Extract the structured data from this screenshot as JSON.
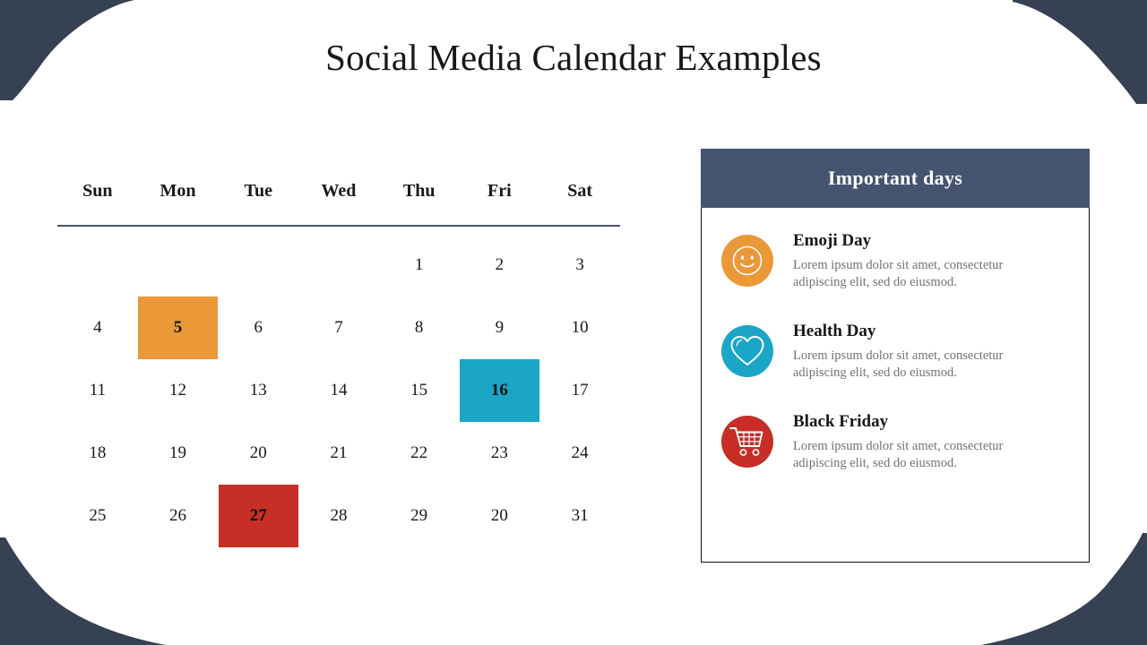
{
  "slide": {
    "title": "Social Media Calendar Examples",
    "background_color": "#ffffff",
    "accent_navy": "#364153"
  },
  "decor": {
    "corner_color": "#364153",
    "corners": [
      "top-left",
      "top-right",
      "bottom-left",
      "bottom-right"
    ]
  },
  "calendar": {
    "weekdays": [
      "Sun",
      "Mon",
      "Tue",
      "Wed",
      "Thu",
      "Fri",
      "Sat"
    ],
    "rows": [
      [
        {
          "label": "",
          "highlight": "none"
        },
        {
          "label": "",
          "highlight": "none"
        },
        {
          "label": "",
          "highlight": "none"
        },
        {
          "label": "",
          "highlight": "none"
        },
        {
          "label": "1",
          "highlight": "none"
        },
        {
          "label": "2",
          "highlight": "none"
        },
        {
          "label": "3",
          "highlight": "none"
        }
      ],
      [
        {
          "label": "4",
          "highlight": "none"
        },
        {
          "label": "5",
          "highlight": "orange"
        },
        {
          "label": "6",
          "highlight": "none"
        },
        {
          "label": "7",
          "highlight": "none"
        },
        {
          "label": "8",
          "highlight": "none"
        },
        {
          "label": "9",
          "highlight": "none"
        },
        {
          "label": "10",
          "highlight": "none"
        }
      ],
      [
        {
          "label": "11",
          "highlight": "none"
        },
        {
          "label": "12",
          "highlight": "none"
        },
        {
          "label": "13",
          "highlight": "none"
        },
        {
          "label": "14",
          "highlight": "none"
        },
        {
          "label": "15",
          "highlight": "none"
        },
        {
          "label": "16",
          "highlight": "blue"
        },
        {
          "label": "17",
          "highlight": "none"
        }
      ],
      [
        {
          "label": "18",
          "highlight": "none"
        },
        {
          "label": "19",
          "highlight": "none"
        },
        {
          "label": "20",
          "highlight": "none"
        },
        {
          "label": "21",
          "highlight": "none"
        },
        {
          "label": "22",
          "highlight": "none"
        },
        {
          "label": "23",
          "highlight": "none"
        },
        {
          "label": "24",
          "highlight": "none"
        }
      ],
      [
        {
          "label": "25",
          "highlight": "none"
        },
        {
          "label": "26",
          "highlight": "none"
        },
        {
          "label": "27",
          "highlight": "red"
        },
        {
          "label": "28",
          "highlight": "none"
        },
        {
          "label": "29",
          "highlight": "none"
        },
        {
          "label": "20",
          "highlight": "none"
        },
        {
          "label": "31",
          "highlight": "none"
        }
      ]
    ],
    "highlight_colors": {
      "orange": "#eb9838",
      "blue": "#1ba6c8",
      "red": "#c62e27"
    },
    "rule_color": "#4a5468"
  },
  "panel": {
    "header_title": "Important days",
    "header_color": "#44546e",
    "items": [
      {
        "title": "Emoji Day",
        "description": "Lorem ipsum dolor sit amet, consectetur adipiscing elit, sed do eiusmod.",
        "icon": "smiley-icon",
        "color": "#eb9838"
      },
      {
        "title": "Health Day",
        "description": "Lorem ipsum dolor sit amet, consectetur adipiscing elit, sed do eiusmod.",
        "icon": "heart-icon",
        "color": "#1ba6c8"
      },
      {
        "title": "Black Friday",
        "description": "Lorem ipsum dolor sit amet, consectetur adipiscing elit, sed do eiusmod.",
        "icon": "shopping-cart-icon",
        "color": "#c62e27"
      }
    ]
  }
}
